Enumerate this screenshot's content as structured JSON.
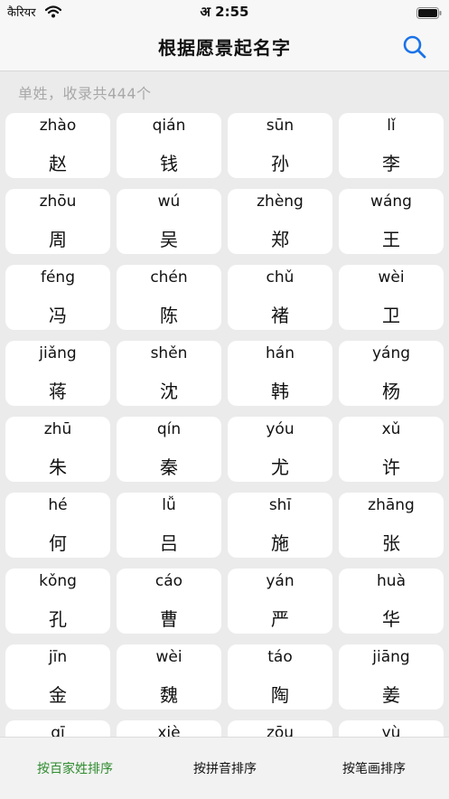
{
  "status_bar": {
    "carrier": "कैरियर",
    "time": "अ 2:55",
    "icons": [
      "wifi-icon",
      "battery-icon"
    ]
  },
  "nav": {
    "title": "根据愿景起名字",
    "search_icon": "search-icon",
    "accent": "#1a73e8"
  },
  "summary": "单姓，收录共444个",
  "surnames": [
    {
      "pinyin": "zhào",
      "hanzi": "赵"
    },
    {
      "pinyin": "qián",
      "hanzi": "钱"
    },
    {
      "pinyin": "sūn",
      "hanzi": "孙"
    },
    {
      "pinyin": "lǐ",
      "hanzi": "李"
    },
    {
      "pinyin": "zhōu",
      "hanzi": "周"
    },
    {
      "pinyin": "wú",
      "hanzi": "吴"
    },
    {
      "pinyin": "zhèng",
      "hanzi": "郑"
    },
    {
      "pinyin": "wáng",
      "hanzi": "王"
    },
    {
      "pinyin": "féng",
      "hanzi": "冯"
    },
    {
      "pinyin": "chén",
      "hanzi": "陈"
    },
    {
      "pinyin": "chǔ",
      "hanzi": "褚"
    },
    {
      "pinyin": "wèi",
      "hanzi": "卫"
    },
    {
      "pinyin": "jiǎng",
      "hanzi": "蒋"
    },
    {
      "pinyin": "shěn",
      "hanzi": "沈"
    },
    {
      "pinyin": "hán",
      "hanzi": "韩"
    },
    {
      "pinyin": "yáng",
      "hanzi": "杨"
    },
    {
      "pinyin": "zhū",
      "hanzi": "朱"
    },
    {
      "pinyin": "qín",
      "hanzi": "秦"
    },
    {
      "pinyin": "yóu",
      "hanzi": "尤"
    },
    {
      "pinyin": "xǔ",
      "hanzi": "许"
    },
    {
      "pinyin": "hé",
      "hanzi": "何"
    },
    {
      "pinyin": "lǚ",
      "hanzi": "吕"
    },
    {
      "pinyin": "shī",
      "hanzi": "施"
    },
    {
      "pinyin": "zhāng",
      "hanzi": "张"
    },
    {
      "pinyin": "kǒng",
      "hanzi": "孔"
    },
    {
      "pinyin": "cáo",
      "hanzi": "曹"
    },
    {
      "pinyin": "yán",
      "hanzi": "严"
    },
    {
      "pinyin": "huà",
      "hanzi": "华"
    },
    {
      "pinyin": "jīn",
      "hanzi": "金"
    },
    {
      "pinyin": "wèi",
      "hanzi": "魏"
    },
    {
      "pinyin": "táo",
      "hanzi": "陶"
    },
    {
      "pinyin": "jiāng",
      "hanzi": "姜"
    },
    {
      "pinyin": "qī",
      "hanzi": ""
    },
    {
      "pinyin": "xiè",
      "hanzi": ""
    },
    {
      "pinyin": "zōu",
      "hanzi": ""
    },
    {
      "pinyin": "yù",
      "hanzi": ""
    }
  ],
  "tabs": [
    {
      "label": "按百家姓排序",
      "active": true
    },
    {
      "label": "按拼音排序",
      "active": false
    },
    {
      "label": "按笔画排序",
      "active": false
    }
  ],
  "colors": {
    "active_tab": "#2e8b2e",
    "background": "#ebebeb",
    "card": "#ffffff"
  }
}
